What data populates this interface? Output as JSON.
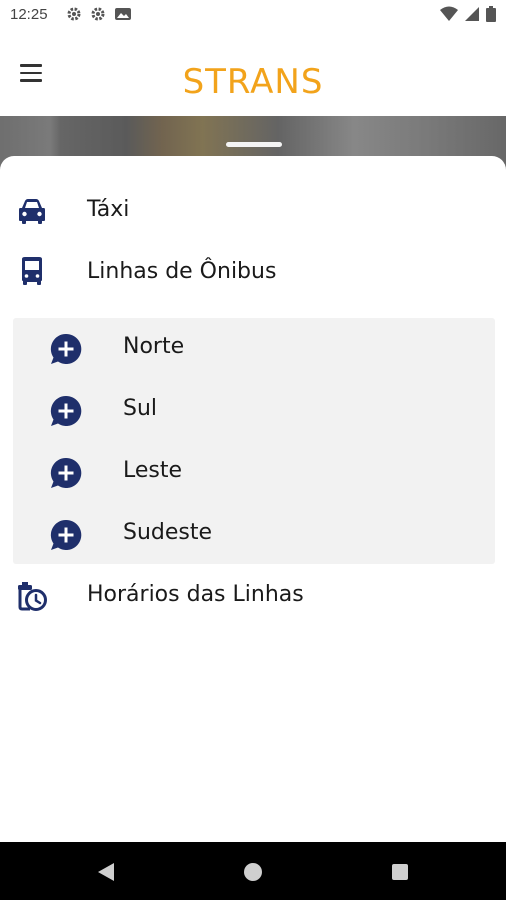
{
  "status_bar": {
    "time": "12:25"
  },
  "app_bar": {
    "title": "STRANS"
  },
  "menu": {
    "items": [
      {
        "label": "Táxi",
        "icon": "car-icon"
      },
      {
        "label": "Linhas de Ônibus",
        "icon": "bus-icon"
      }
    ],
    "submenu": [
      {
        "label": "Norte",
        "icon": "add-chat-icon"
      },
      {
        "label": "Sul",
        "icon": "add-chat-icon"
      },
      {
        "label": "Leste",
        "icon": "add-chat-icon"
      },
      {
        "label": "Sudeste",
        "icon": "add-chat-icon"
      }
    ],
    "schedule": {
      "label": "Horários das Linhas",
      "icon": "schedule-clock-icon"
    }
  },
  "colors": {
    "accent": "#f2a31b",
    "icon": "#1f2f6b",
    "submenu_bg": "#f2f2f2"
  }
}
